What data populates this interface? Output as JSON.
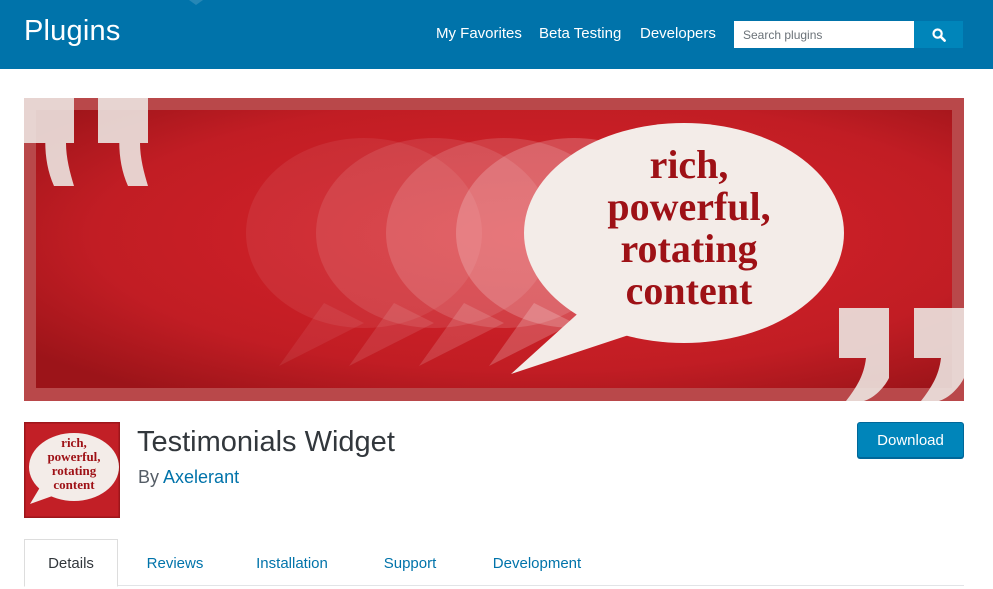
{
  "header": {
    "site_title": "Plugins",
    "nav": [
      {
        "label": "My Favorites"
      },
      {
        "label": "Beta Testing"
      },
      {
        "label": "Developers"
      }
    ],
    "search": {
      "placeholder": "Search plugins",
      "value": "",
      "button_icon": "search-icon"
    }
  },
  "banner": {
    "text_lines": [
      "rich,",
      "powerful,",
      "rotating",
      "content"
    ],
    "colors": {
      "background": "#b32025",
      "text": "#9e1116",
      "bubble": "#f3ece8"
    }
  },
  "plugin": {
    "icon_text_lines": [
      "rich,",
      "powerful,",
      "rotating",
      "content"
    ],
    "title": "Testimonials Widget",
    "by_prefix": "By",
    "author": "Axelerant",
    "download_label": "Download"
  },
  "tabs": [
    {
      "label": "Details",
      "active": true
    },
    {
      "label": "Reviews",
      "active": false
    },
    {
      "label": "Installation",
      "active": false
    },
    {
      "label": "Support",
      "active": false
    },
    {
      "label": "Development",
      "active": false
    }
  ],
  "colors": {
    "header": "#0073aa",
    "button": "#0085ba",
    "link": "#0073aa"
  }
}
